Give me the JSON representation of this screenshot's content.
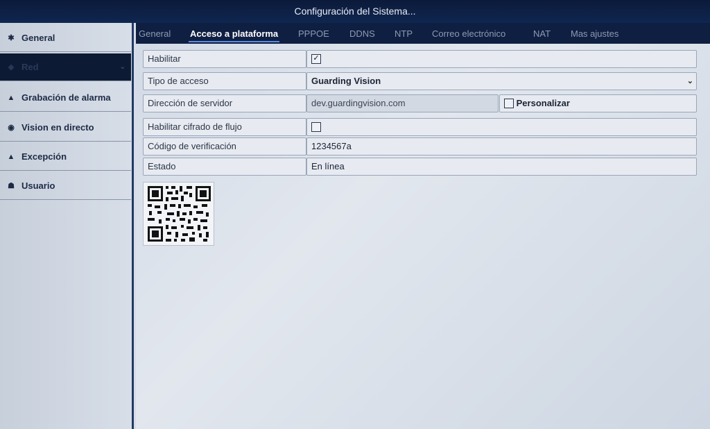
{
  "window": {
    "title": "Configuración del Sistema..."
  },
  "sidebar": {
    "items": [
      {
        "label": "General",
        "icon": "gear-icon"
      },
      {
        "label": "Red",
        "icon": "network-icon",
        "caret": "⌄"
      },
      {
        "label": "Grabación de alarma",
        "icon": "alarm-icon"
      },
      {
        "label": "Vision en directo",
        "icon": "eye-icon"
      },
      {
        "label": "Excepción",
        "icon": "warning-icon"
      },
      {
        "label": "Usuario",
        "icon": "users-icon"
      }
    ],
    "active_index": 1
  },
  "tabs": [
    {
      "label": "General"
    },
    {
      "label": "Acceso a plataforma",
      "active": true
    },
    {
      "label": "PPPOE"
    },
    {
      "label": "DDNS"
    },
    {
      "label": "NTP"
    },
    {
      "label": "Correo electrónico"
    },
    {
      "label": "NAT"
    },
    {
      "label": "Mas ajustes"
    }
  ],
  "form": {
    "enable": {
      "label": "Habilitar",
      "checked": true,
      "mark": "✓"
    },
    "access_type": {
      "label": "Tipo de acceso",
      "value": "Guarding Vision",
      "caret": "⌄"
    },
    "server": {
      "label": "Dirección de servidor",
      "value": "dev.guardingvision.com",
      "custom_label": "Personalizar",
      "custom_checked": false
    },
    "stream_encryption": {
      "label": "Habilitar cifrado de flujo",
      "checked": false
    },
    "verification_code": {
      "label": "Código de verificación",
      "value": "1234567a"
    },
    "status": {
      "label": "Estado",
      "value": "En línea"
    }
  }
}
